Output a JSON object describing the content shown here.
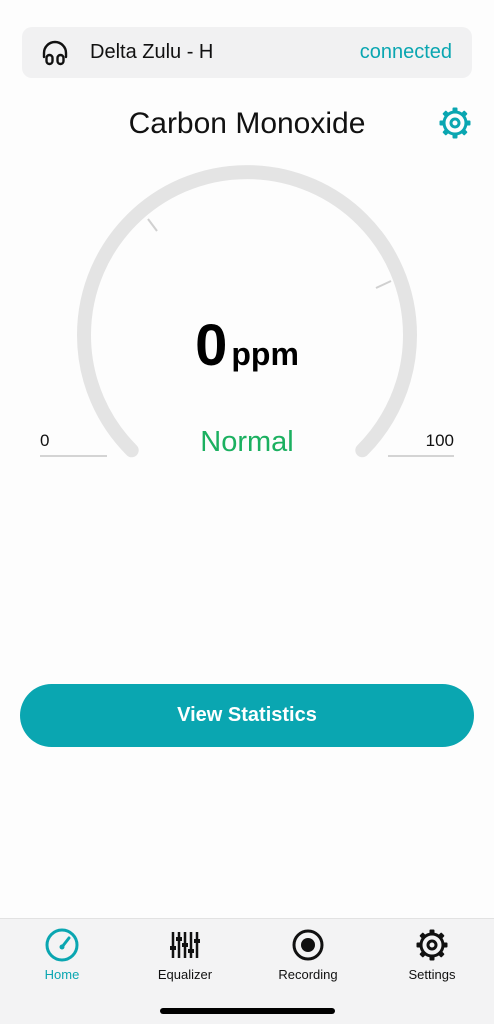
{
  "colors": {
    "accent": "#0aa6b1",
    "status_normal": "#1bb060",
    "gauge_track": "#e4e4e4"
  },
  "device": {
    "icon": "headphones-icon",
    "name": "Delta Zulu - H",
    "status": "connected"
  },
  "sensor": {
    "title": "Carbon Monoxide",
    "settings_icon": "gear-icon"
  },
  "gauge": {
    "value": "0",
    "unit": "ppm",
    "status": "Normal",
    "min": "0",
    "max": "100",
    "level": 0
  },
  "actions": {
    "view_statistics": "View Statistics"
  },
  "tabbar": {
    "items": [
      {
        "label": "Home",
        "icon": "speedometer-icon",
        "active": true
      },
      {
        "label": "Equalizer",
        "icon": "equalizer-icon",
        "active": false
      },
      {
        "label": "Recording",
        "icon": "record-icon",
        "active": false
      },
      {
        "label": "Settings",
        "icon": "gear-icon",
        "active": false
      }
    ]
  }
}
